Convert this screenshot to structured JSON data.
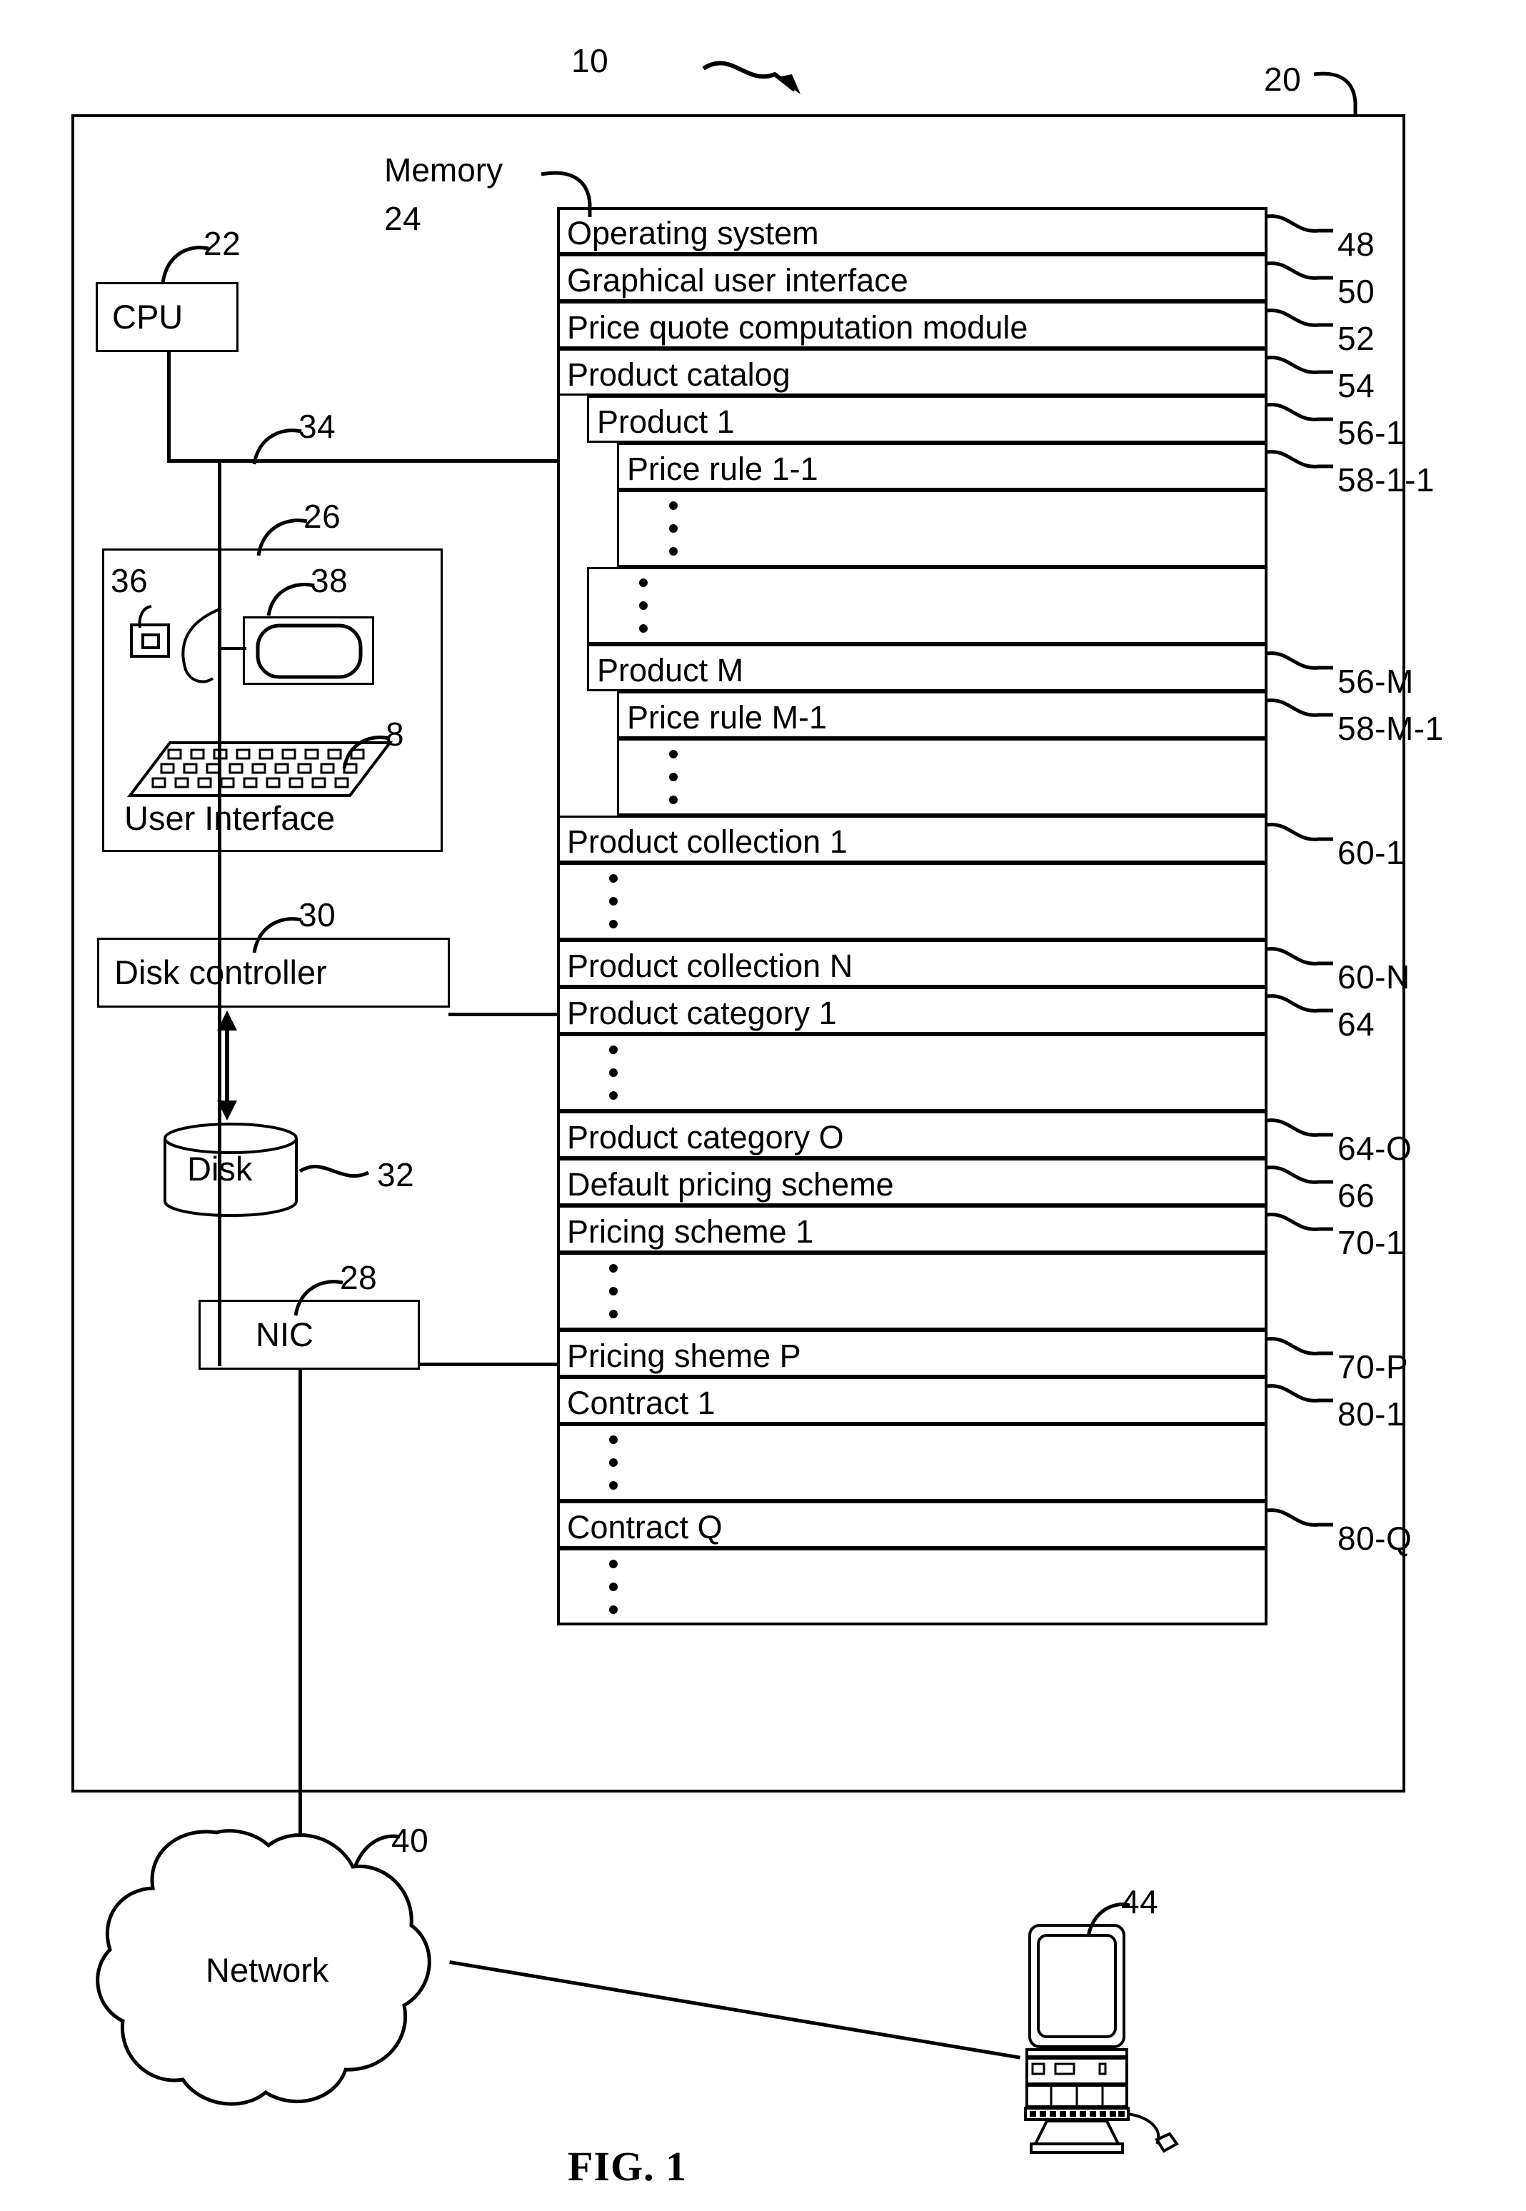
{
  "figure": {
    "caption": "FIG. 1",
    "system_ref": "10",
    "outer_box_ref": "20"
  },
  "memory": {
    "label": "Memory",
    "ref": "24",
    "rows": [
      {
        "text": "Operating system",
        "ref": "48",
        "indent": 0,
        "kind": "text"
      },
      {
        "text": "Graphical user interface",
        "ref": "50",
        "indent": 0,
        "kind": "text"
      },
      {
        "text": "Price quote computation module",
        "ref": "52",
        "indent": 0,
        "kind": "text"
      },
      {
        "text": "Product catalog",
        "ref": "54",
        "indent": 0,
        "kind": "text"
      },
      {
        "text": "Product 1",
        "ref": "56-1",
        "indent": 1,
        "kind": "text"
      },
      {
        "text": "Price rule 1-1",
        "ref": "58-1-1",
        "indent": 2,
        "kind": "text"
      },
      {
        "text": "",
        "ref": "",
        "indent": 2,
        "kind": "vdots"
      },
      {
        "text": "",
        "ref": "",
        "indent": 1,
        "kind": "vdots"
      },
      {
        "text": "Product M",
        "ref": "56-M",
        "indent": 1,
        "kind": "text"
      },
      {
        "text": "Price rule M-1",
        "ref": "58-M-1",
        "indent": 2,
        "kind": "text"
      },
      {
        "text": "",
        "ref": "",
        "indent": 2,
        "kind": "vdots"
      },
      {
        "text": "Product collection 1",
        "ref": "60-1",
        "indent": 0,
        "kind": "text"
      },
      {
        "text": "",
        "ref": "",
        "indent": 0,
        "kind": "vdots"
      },
      {
        "text": "Product collection N",
        "ref": "60-N",
        "indent": 0,
        "kind": "text"
      },
      {
        "text": "Product category 1",
        "ref": "64",
        "indent": 0,
        "kind": "text"
      },
      {
        "text": "",
        "ref": "",
        "indent": 0,
        "kind": "vdots"
      },
      {
        "text": "Product category O",
        "ref": "64-O",
        "indent": 0,
        "kind": "text"
      },
      {
        "text": "Default pricing scheme",
        "ref": "66",
        "indent": 0,
        "kind": "text"
      },
      {
        "text": "Pricing scheme 1",
        "ref": "70-1",
        "indent": 0,
        "kind": "text"
      },
      {
        "text": "",
        "ref": "",
        "indent": 0,
        "kind": "vdots"
      },
      {
        "text": "Pricing sheme P",
        "ref": "70-P",
        "indent": 0,
        "kind": "text"
      },
      {
        "text": "Contract 1",
        "ref": "80-1",
        "indent": 0,
        "kind": "text"
      },
      {
        "text": "",
        "ref": "",
        "indent": 0,
        "kind": "vdots"
      },
      {
        "text": "Contract Q",
        "ref": "80-Q",
        "indent": 0,
        "kind": "text"
      },
      {
        "text": "",
        "ref": "",
        "indent": 0,
        "kind": "vdots"
      }
    ]
  },
  "components": {
    "cpu": {
      "label": "CPU",
      "ref": "22"
    },
    "bus": {
      "ref": "34"
    },
    "user_interface": {
      "label": "User Interface",
      "ref": "26"
    },
    "mouse": {
      "ref": "36"
    },
    "display": {
      "ref": "38"
    },
    "keyboard": {
      "ref": "8"
    },
    "disk_controller": {
      "label": "Disk controller",
      "ref": "30"
    },
    "disk": {
      "label": "Disk",
      "ref": "32"
    },
    "nic": {
      "label": "NIC",
      "ref": "28"
    },
    "network": {
      "label": "Network",
      "ref": "40"
    },
    "client": {
      "ref": "44"
    }
  }
}
